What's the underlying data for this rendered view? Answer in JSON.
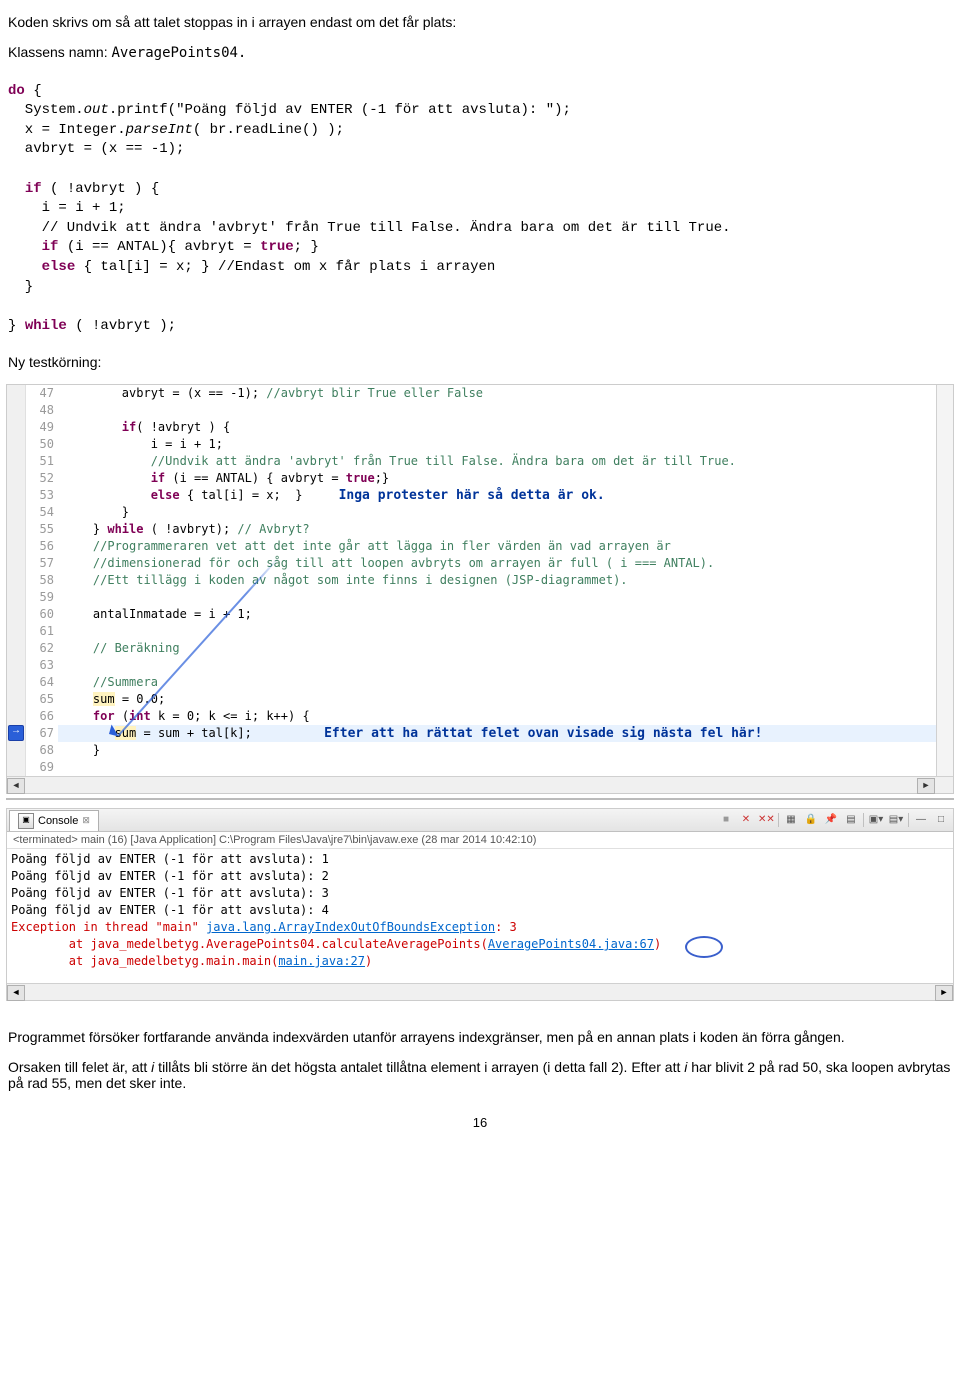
{
  "doc": {
    "intro": "Koden skrivs om så att talet stoppas in i arrayen endast om det får plats:",
    "klassLabel": "Klassens namn: ",
    "klassName": "AveragePoints04.",
    "nyTest": "Ny testkörning:",
    "summary1": "Programmet försöker fortfarande använda indexvärden utanför arrayens indexgränser, men på en annan plats i koden än förra gången.",
    "summary2a": "Orsaken till felet är, att ",
    "summary2b": "i",
    "summary2c": " tillåts bli större än det högsta antalet tillåtna element i arrayen (i detta fall 2). Efter att ",
    "summary2d": "i",
    "summary2e": " har blivit 2 på rad 50, ska loopen avbrytas på rad 55, men det sker inte.",
    "pageNum": "16"
  },
  "snippet": {
    "l1": "do {",
    "l2": "  System.out.printf(\"Poäng följd av ENTER (-1 för att avsluta): \");",
    "l3": "  x = Integer.parseInt( br.readLine() );",
    "l4": "  avbryt = (x == -1);",
    "l5": "",
    "l6": "  if ( !avbryt ) {",
    "l7": "    i = i + 1;",
    "l8": "    // Undvik att ändra 'avbryt' från True till False. Ändra bara om det är till True.",
    "l9": "    if (i == ANTAL){ avbryt = true; }",
    "l10": "    else { tal[i] = x; } //Endast om x får plats i arrayen",
    "l11": "  }",
    "l12": "",
    "l13": "} while ( !avbryt );"
  },
  "editor": {
    "lines": [
      "47",
      "48",
      "49",
      "50",
      "51",
      "52",
      "53",
      "54",
      "55",
      "56",
      "57",
      "58",
      "59",
      "60",
      "61",
      "62",
      "63",
      "64",
      "65",
      "66",
      "67",
      "68",
      "69"
    ],
    "callout53": "Inga protester här så detta är ok.",
    "callout67": "Efter att ha rättat felet ovan visade sig nästa fel här!"
  },
  "console": {
    "tabTitle": "Console",
    "status": "<terminated> main (16) [Java Application] C:\\Program Files\\Java\\jre7\\bin\\javaw.exe (28 mar 2014 10:42:10)",
    "lines": [
      "Poäng följd av ENTER (-1 för att avsluta): 1",
      "Poäng följd av ENTER (-1 för att avsluta): 2",
      "Poäng följd av ENTER (-1 för att avsluta): 3",
      "Poäng följd av ENTER (-1 för att avsluta): 4"
    ],
    "exception": "Exception in thread \"main\" ",
    "exceptionLink": "java.lang.ArrayIndexOutOfBoundsException",
    "exceptionTail": ": 3",
    "trace1a": "        at java_medelbetyg.AveragePoints04.calculateAveragePoints(",
    "trace1b": "AveragePoints04.java:67",
    "trace1c": ")",
    "trace2a": "        at java_medelbetyg.main.main(",
    "trace2b": "main.java:27",
    "trace2c": ")"
  }
}
